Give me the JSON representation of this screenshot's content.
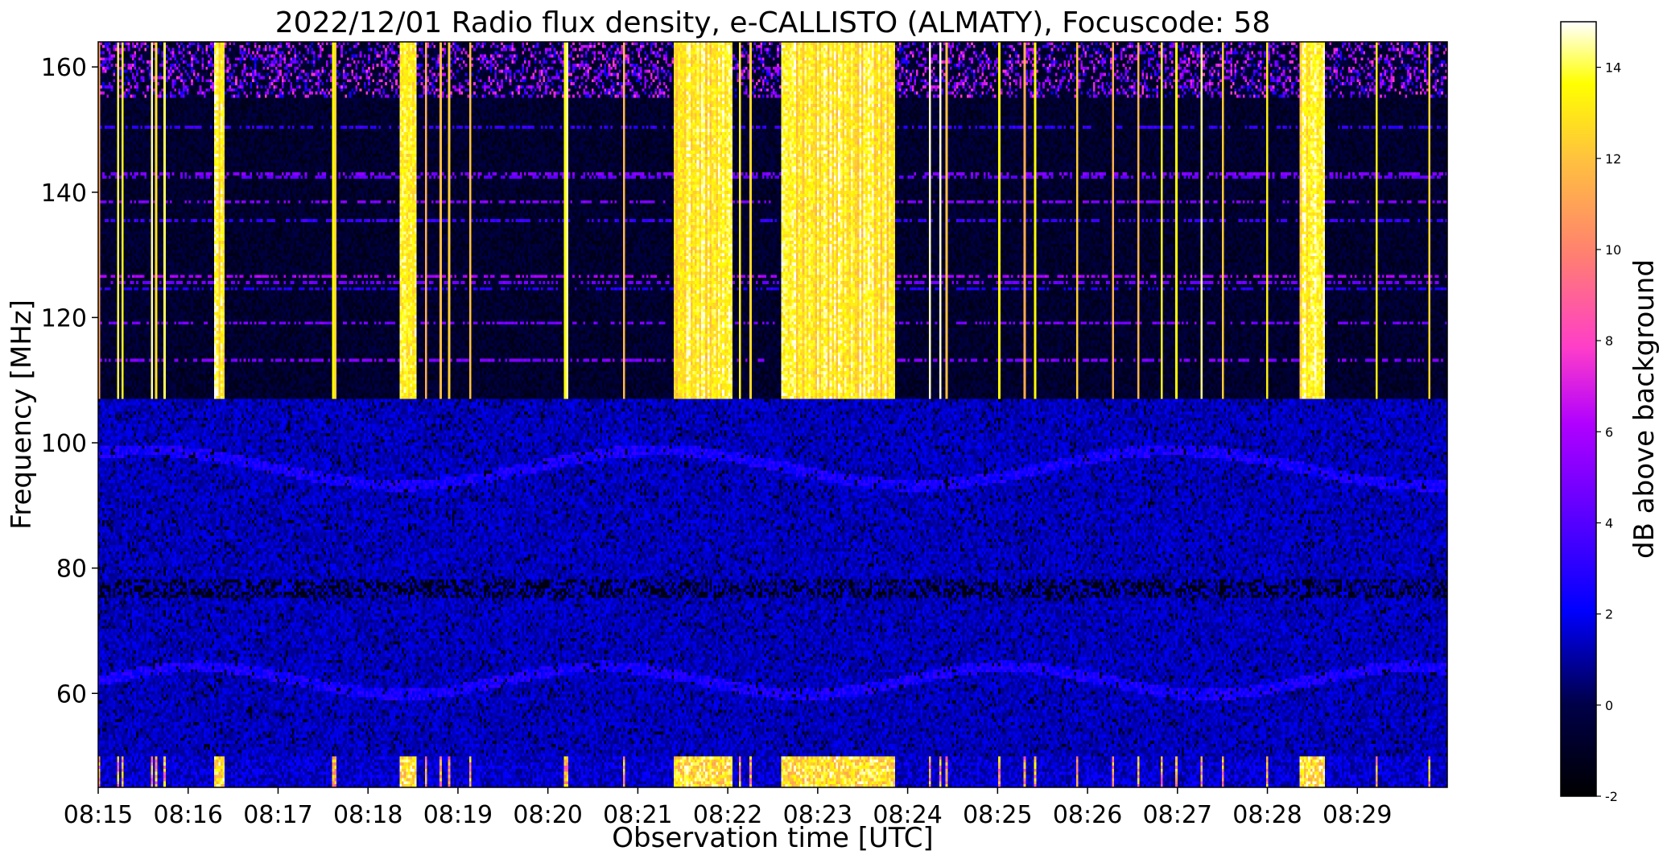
{
  "chart_data": {
    "type": "heatmap",
    "title": "2022/12/01  Radio flux density, e-CALLISTO (ALMATY), Focuscode: 58",
    "xlabel": "Observation time [UTC]",
    "ylabel": "Frequency [MHz]",
    "colorbar_label": "dB above background",
    "x_ticks": [
      "08:15",
      "08:16",
      "08:17",
      "08:18",
      "08:19",
      "08:20",
      "08:21",
      "08:22",
      "08:23",
      "08:24",
      "08:25",
      "08:26",
      "08:27",
      "08:28",
      "08:29"
    ],
    "x_range_minutes": [
      0,
      15
    ],
    "y_ticks": [
      60,
      80,
      100,
      120,
      140,
      160
    ],
    "ylim": [
      45,
      164
    ],
    "colorbar_ticks": [
      -2,
      0,
      2,
      4,
      6,
      8,
      10,
      12,
      14
    ],
    "clim": [
      -2,
      15
    ],
    "colormap": [
      "#000000",
      "#0000ff",
      "#8a00ff",
      "#ff3ec8",
      "#ff8a5a",
      "#ffff00",
      "#ffffff"
    ],
    "bright_bursts_minutes": [
      [
        1.3,
        1.4
      ],
      [
        3.35,
        3.55
      ],
      [
        6.4,
        7.05
      ],
      [
        7.6,
        8.85
      ],
      [
        13.35,
        13.65
      ]
    ],
    "interference_band_mhz": [
      45,
      50
    ],
    "upper_band_start_mhz": 107,
    "grid": false
  }
}
